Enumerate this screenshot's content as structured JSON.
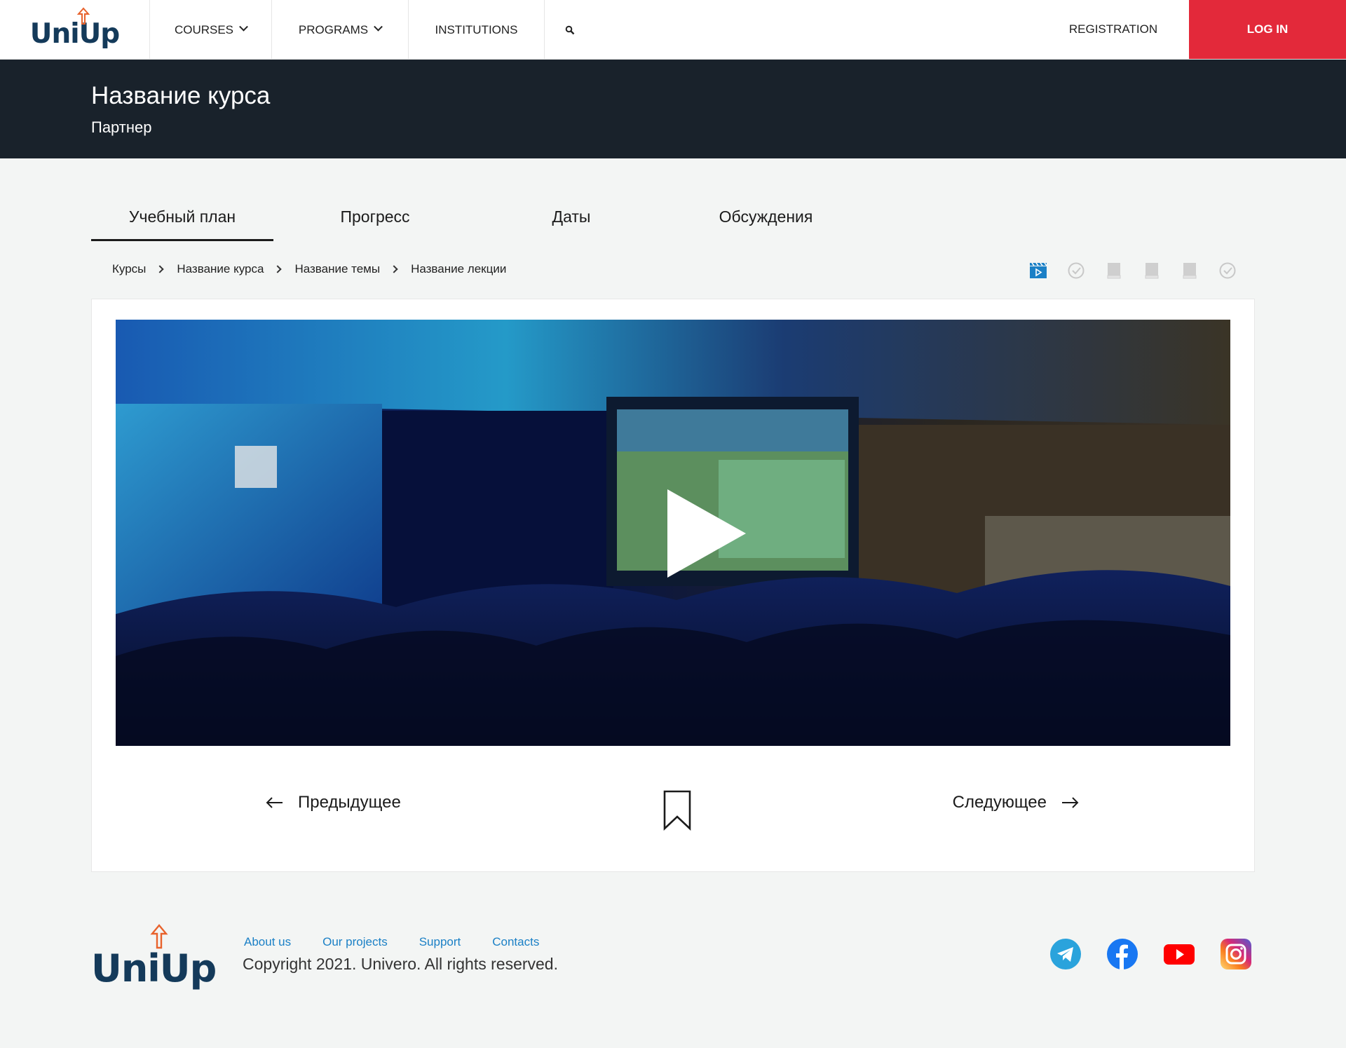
{
  "header": {
    "logo_text": "UniUp",
    "nav": [
      {
        "label": "COURSES",
        "dropdown": true
      },
      {
        "label": "PROGRAMS",
        "dropdown": true
      },
      {
        "label": "INSTITUTIONS",
        "dropdown": false
      }
    ],
    "search_icon": "search-icon",
    "registration_label": "REGISTRATION",
    "login_label": "LOG IN",
    "login_color": "#e3293a"
  },
  "hero": {
    "title": "Название курса",
    "partner": "Партнер"
  },
  "tabs": [
    {
      "label": "Учебный план",
      "active": true
    },
    {
      "label": "Прогресс",
      "active": false
    },
    {
      "label": "Даты",
      "active": false
    },
    {
      "label": "Обсуждения",
      "active": false
    }
  ],
  "breadcrumb": [
    "Курсы",
    "Название курса",
    "Название темы",
    "Название лекции"
  ],
  "unit_icons": [
    "video-icon",
    "check-circle-icon",
    "book-icon",
    "book-icon",
    "book-icon",
    "check-circle-icon"
  ],
  "lesson": {
    "video_icon": "play-icon",
    "prev_label": "Предыдущее",
    "next_label": "Следующее",
    "bookmark_icon": "bookmark-icon"
  },
  "footer": {
    "logo_text": "UniUp",
    "links": [
      "About us",
      "Our projects",
      "Support",
      "Contacts"
    ],
    "copyright": "Copyright 2021. Univero. All rights reserved.",
    "social": [
      "telegram-icon",
      "facebook-icon",
      "youtube-icon",
      "instagram-icon"
    ]
  }
}
